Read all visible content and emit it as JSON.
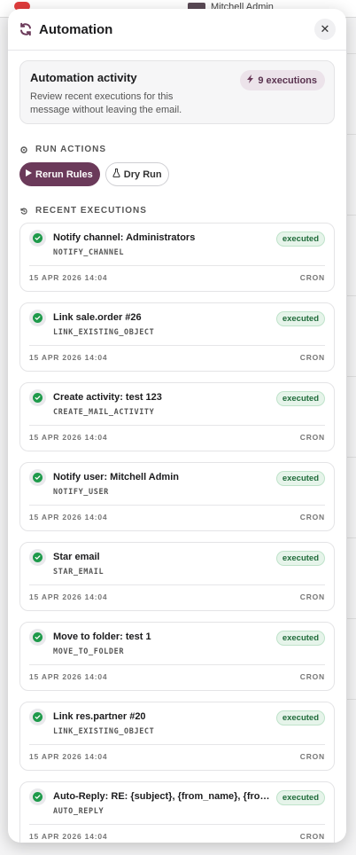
{
  "background": {
    "user_name": "Mitchell Admin"
  },
  "panel": {
    "title": "Automation",
    "close_label": "✕"
  },
  "activity": {
    "title": "Automation activity",
    "description": "Review recent executions for this message without leaving the email.",
    "executions_pill": "9 executions"
  },
  "run_actions": {
    "label": "RUN ACTIONS",
    "rerun_label": "Rerun Rules",
    "dry_run_label": "Dry Run"
  },
  "recent": {
    "label": "RECENT EXECUTIONS",
    "items": [
      {
        "name": "Notify channel: Administrators",
        "code": "NOTIFY_CHANNEL",
        "status": "executed",
        "time": "15 APR 2026 14:04",
        "source": "CRON"
      },
      {
        "name": "Link sale.order #26",
        "code": "LINK_EXISTING_OBJECT",
        "status": "executed",
        "time": "15 APR 2026 14:04",
        "source": "CRON"
      },
      {
        "name": "Create activity: test 123",
        "code": "CREATE_MAIL_ACTIVITY",
        "status": "executed",
        "time": "15 APR 2026 14:04",
        "source": "CRON"
      },
      {
        "name": "Notify user: Mitchell Admin",
        "code": "NOTIFY_USER",
        "status": "executed",
        "time": "15 APR 2026 14:04",
        "source": "CRON"
      },
      {
        "name": "Star email",
        "code": "STAR_EMAIL",
        "status": "executed",
        "time": "15 APR 2026 14:04",
        "source": "CRON"
      },
      {
        "name": "Move to folder: test 1",
        "code": "MOVE_TO_FOLDER",
        "status": "executed",
        "time": "15 APR 2026 14:04",
        "source": "CRON"
      },
      {
        "name": "Link res.partner #20",
        "code": "LINK_EXISTING_OBJECT",
        "status": "executed",
        "time": "15 APR 2026 14:04",
        "source": "CRON"
      },
      {
        "name": "Auto-Reply: RE: {subject}, {from_name}, {from_email}",
        "code": "AUTO_REPLY",
        "status": "executed",
        "time": "15 APR 2026 14:04",
        "source": "CRON"
      }
    ]
  },
  "colors": {
    "accent": "#6b3a5a",
    "success": "#1e9a4a",
    "success_bg": "#e6f4ea"
  },
  "icons": {
    "header": "refresh-icon",
    "pill": "bolt-icon",
    "run_section": "circle-dot-icon",
    "rerun": "play-icon",
    "dry_run": "flask-icon",
    "recent_section": "history-icon",
    "status": "check-circle-icon"
  }
}
